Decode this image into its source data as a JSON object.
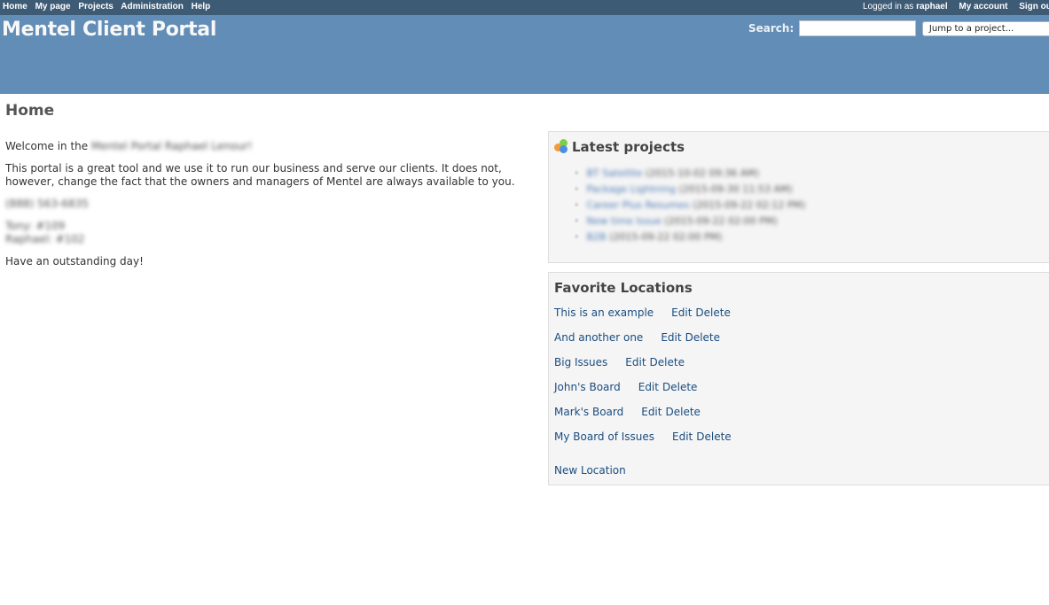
{
  "top_menu": {
    "items": [
      "Home",
      "My page",
      "Projects",
      "Administration",
      "Help"
    ],
    "logged_in_prefix": "Logged in as",
    "username": "raphael",
    "my_account": "My account",
    "sign_out": "Sign out"
  },
  "header": {
    "title": "Mentel Client Portal",
    "search_label": "Search:",
    "search_value": "",
    "jump_placeholder": "Jump to a project..."
  },
  "page": {
    "title": "Home",
    "welcome_prefix": "Welcome in the",
    "welcome_blurred": "Mentel Portal Raphael Lenour!",
    "intro": "This portal is a great tool and we use it to run our business and serve our clients. It does not, however, change the fact that the owners and managers of Mentel are always available to you.",
    "phone_blurred": "(888) 563-6835",
    "ext_lines_blurred": [
      "Tony: #109",
      "Raphael: #102"
    ],
    "closing": "Have an outstanding day!"
  },
  "latest_projects": {
    "title": "Latest projects",
    "icon": "projects-icon",
    "items": [
      {
        "name": "BT Satellite",
        "date": "(2015-10-02 09:36 AM)"
      },
      {
        "name": "Package Lightning",
        "date": "(2015-09-30 11:53 AM)"
      },
      {
        "name": "Career Plus Resumes",
        "date": "(2015-09-22 02:12 PM)"
      },
      {
        "name": "New time Issue",
        "date": "(2015-09-22 02:00 PM)"
      },
      {
        "name": "B2B",
        "date": "(2015-09-22 02:00 PM)"
      }
    ]
  },
  "favorites": {
    "title": "Favorite Locations",
    "edit_label": "Edit",
    "delete_label": "Delete",
    "items": [
      "This is an example",
      "And another one",
      "Big Issues",
      "John's Board",
      "Mark's Board",
      "My Board of Issues"
    ],
    "new_label": "New Location"
  }
}
